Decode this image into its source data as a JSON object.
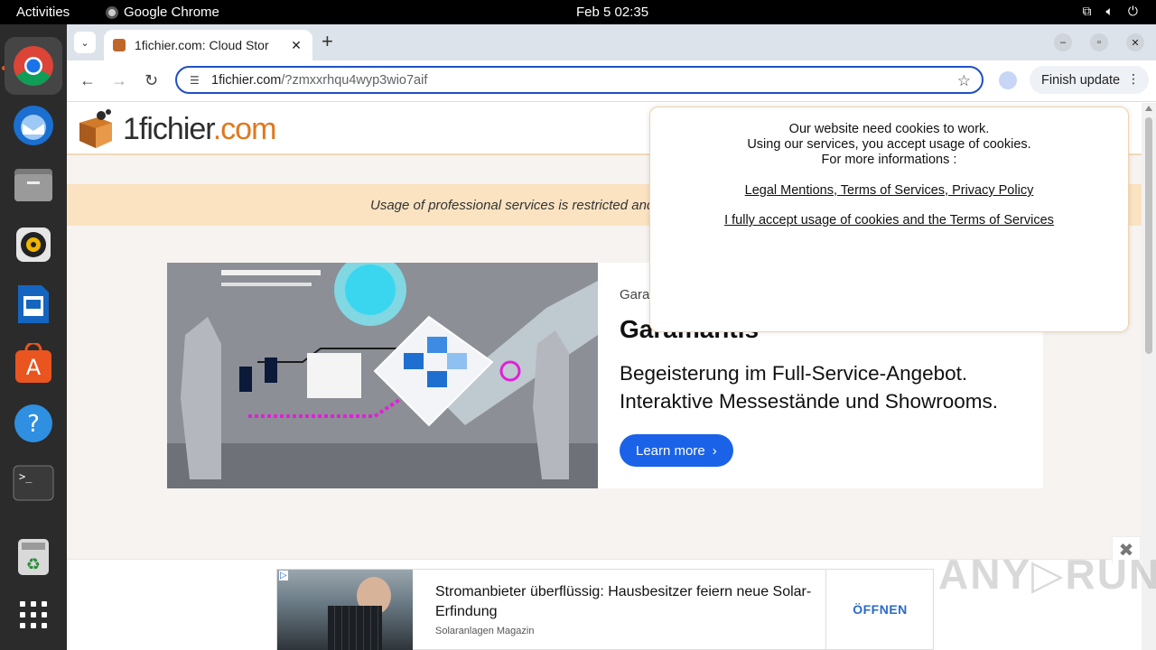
{
  "system": {
    "activities": "Activities",
    "app_name": "Google Chrome",
    "clock": "Feb 5  02:35"
  },
  "dock": {
    "items": [
      "Google Chrome",
      "Thunderbird Mail",
      "Files",
      "Rhythmbox",
      "LibreOffice Writer",
      "Ubuntu Software",
      "Help",
      "Terminal",
      "Trash",
      "Show Applications"
    ]
  },
  "browser": {
    "tab_title": "1fichier.com: Cloud Stor",
    "url_host": "1fichier.com",
    "url_path": "/?zmxxrhqu4wyp3wio7aif",
    "finish_update": "Finish update"
  },
  "site": {
    "logo_part1": "1fichier",
    "logo_part2": ".com",
    "notice": "Usage of professional services is restricted and"
  },
  "banner": {
    "brand_small": "Gara",
    "brand_big": "Garamantis",
    "desc_line1": "Begeisterung im Full-Service-Angebot.",
    "desc_line2": "Interaktive Messestände und Showrooms.",
    "cta": "Learn more"
  },
  "cookie": {
    "line1": "Our website need cookies to work.",
    "line2": "Using our services, you accept usage of cookies.",
    "line3": "For more informations :",
    "legal_link": "Legal Mentions, Terms of Services, Privacy Policy",
    "accept_link": "I fully accept usage of cookies and the Terms of Services"
  },
  "ad": {
    "headline": "Stromanbieter überflüssig: Hausbesitzer feiern neue Solar-Erfindung",
    "source": "Solaranlagen Magazin",
    "cta": "ÖFFNEN"
  },
  "watermark": "ANY.RUN",
  "colors": {
    "accent_blue": "#1a63e8",
    "logo_orange": "#e0781e",
    "notice_bg": "#fbe3c2"
  }
}
